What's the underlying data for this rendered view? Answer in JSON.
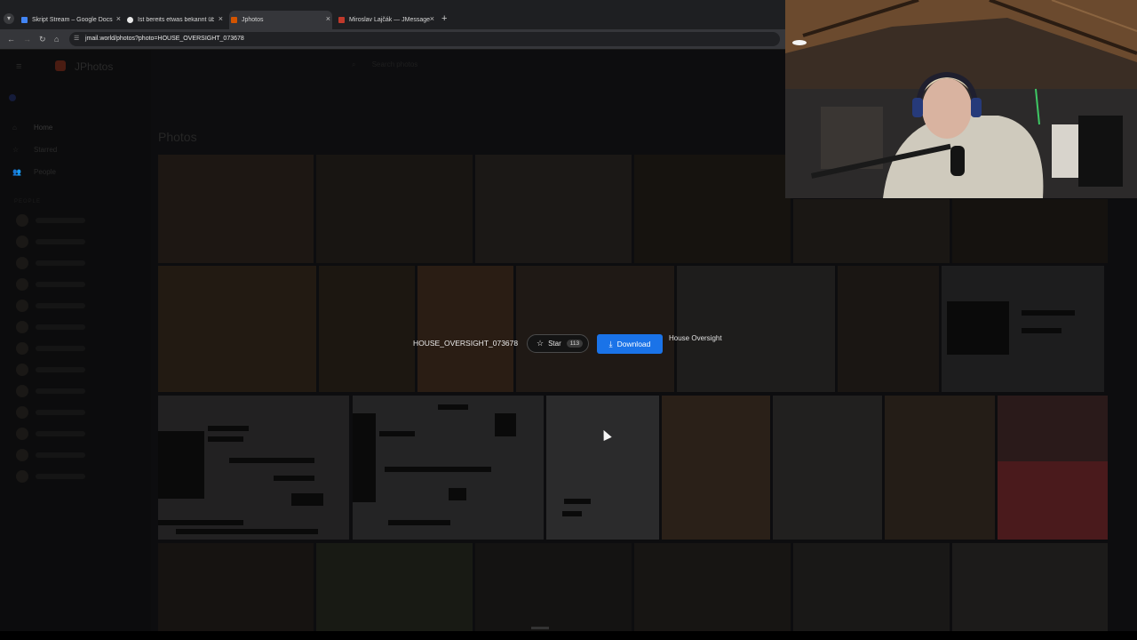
{
  "browser": {
    "tabs": [
      {
        "title": "Skript Stream – Google Docs",
        "favicon_color": "#4285f4",
        "active": false
      },
      {
        "title": "Ist bereits etwas bekannt über ...",
        "favicon_color": "#e8e8e8",
        "active": false
      },
      {
        "title": "Jphotos",
        "favicon_color": "#d35400",
        "active": true
      },
      {
        "title": "Miroslav Lajčák — JMessage",
        "favicon_color": "#c0392b",
        "active": false
      }
    ],
    "new_tab_icon": "plus-icon",
    "url": "jmail.world/photos?photo=HOUSE_OVERSIGHT_073678"
  },
  "app": {
    "brand": "JPhotos",
    "menu_icon": "hamburger-icon",
    "search_placeholder": "Search photos",
    "sidebar": [
      {
        "label": "Home",
        "icon": "home-icon"
      },
      {
        "label": "Starred",
        "icon": "star-icon"
      },
      {
        "label": "People",
        "icon": "people-icon"
      }
    ],
    "people_heading": "PEOPLE",
    "page_title": "Photos"
  },
  "overlay": {
    "photo_name": "HOUSE_OVERSIGHT_073678",
    "star_label": "Star",
    "star_count": "113",
    "download_label": "Download",
    "source": "House Oversight"
  },
  "colors": {
    "accent": "#1a73e8",
    "chrome_dark": "#1e1f22",
    "chrome_toolbar": "#35363a"
  }
}
